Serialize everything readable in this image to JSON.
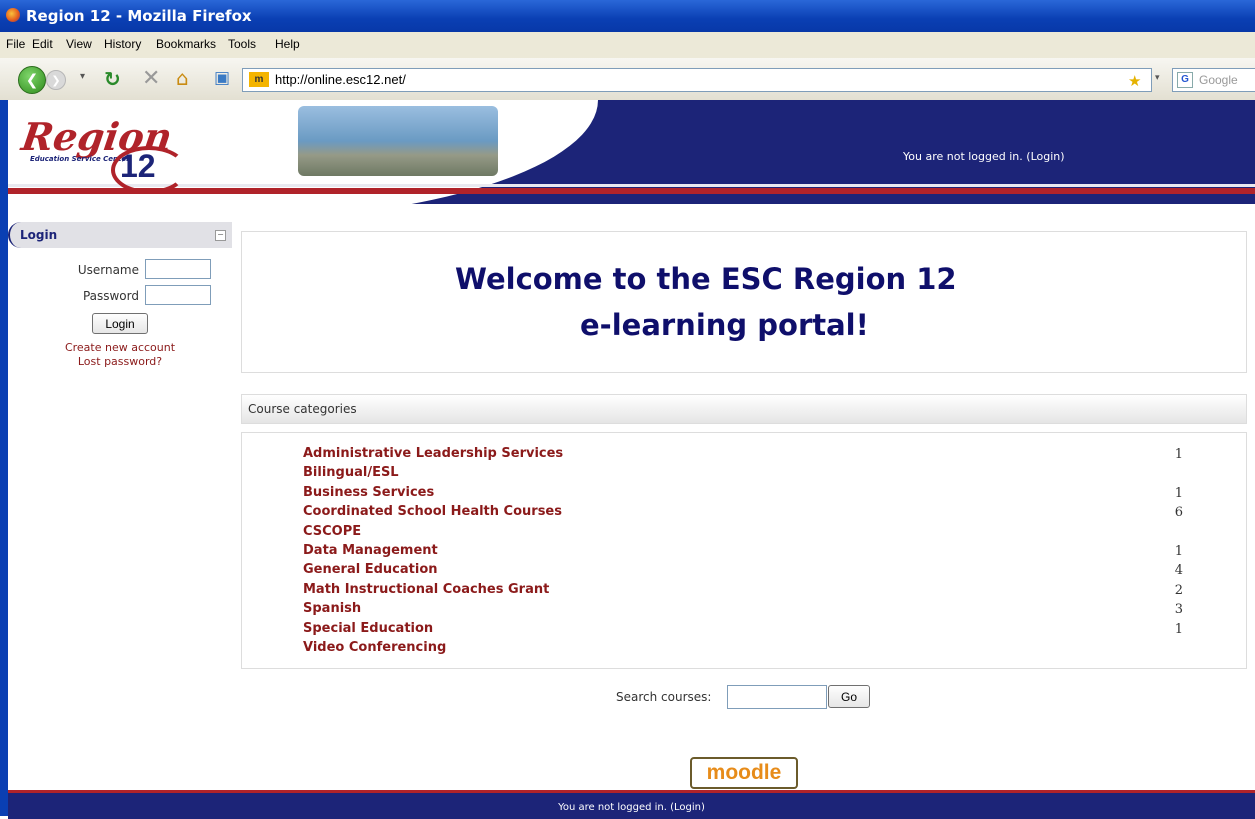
{
  "window": {
    "title": "Region 12 - Mozilla Firefox"
  },
  "menu": [
    "File",
    "Edit",
    "View",
    "History",
    "Bookmarks",
    "Tools",
    "Help"
  ],
  "nav": {
    "url": "http://online.esc12.net/",
    "search_engine_placeholder": "Google"
  },
  "header": {
    "logo_text": "Region",
    "logo_sub": "Education Service Center",
    "logo_number": "12",
    "login_status": "You are not logged in. (Login)"
  },
  "login_block": {
    "title": "Login",
    "username_label": "Username",
    "password_label": "Password",
    "login_button": "Login",
    "create_account": "Create new account",
    "lost_password": "Lost password?"
  },
  "welcome": {
    "line1": "Welcome to the ESC Region 12",
    "line2": "e-learning portal!"
  },
  "categories": {
    "title": "Course categories",
    "items": [
      {
        "name": "Administrative Leadership Services",
        "count": "1"
      },
      {
        "name": "Bilingual/ESL",
        "count": ""
      },
      {
        "name": "Business Services",
        "count": "1"
      },
      {
        "name": "Coordinated School Health Courses",
        "count": "6"
      },
      {
        "name": "CSCOPE",
        "count": ""
      },
      {
        "name": "Data Management",
        "count": "1"
      },
      {
        "name": "General Education",
        "count": "4"
      },
      {
        "name": "Math Instructional Coaches Grant",
        "count": "2"
      },
      {
        "name": "Spanish",
        "count": "3"
      },
      {
        "name": "Special Education",
        "count": "1"
      },
      {
        "name": "Video Conferencing",
        "count": ""
      }
    ]
  },
  "search": {
    "label": "Search courses:",
    "button": "Go"
  },
  "footer": {
    "moodle_logo": "moodle",
    "login_status": "You are not logged in. (Login)"
  }
}
